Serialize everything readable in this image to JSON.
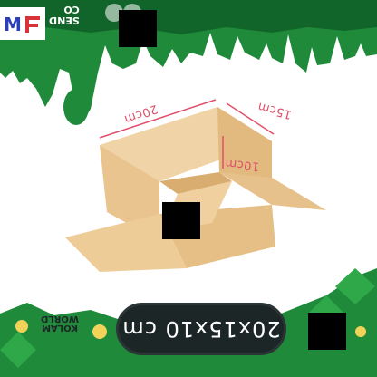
{
  "box": {
    "dimension_length": "20cm",
    "dimension_width": "15cm",
    "dimension_height": "10cm",
    "size_badge": "20x15x10 cm"
  },
  "brand": {
    "top_line1": "SEND",
    "top_line2": "CO",
    "bottom_line1": "KOLAM",
    "bottom_line2": "WORLD"
  },
  "colors": {
    "banner_green": "#1f8a3a",
    "banner_dark_green": "#12652a",
    "cardboard": "#e9c48e",
    "cardboard_shade": "#d9ad70",
    "label_pink": "#e0506a",
    "badge_bg": "#1d2626",
    "badge_text": "#ffffff"
  }
}
